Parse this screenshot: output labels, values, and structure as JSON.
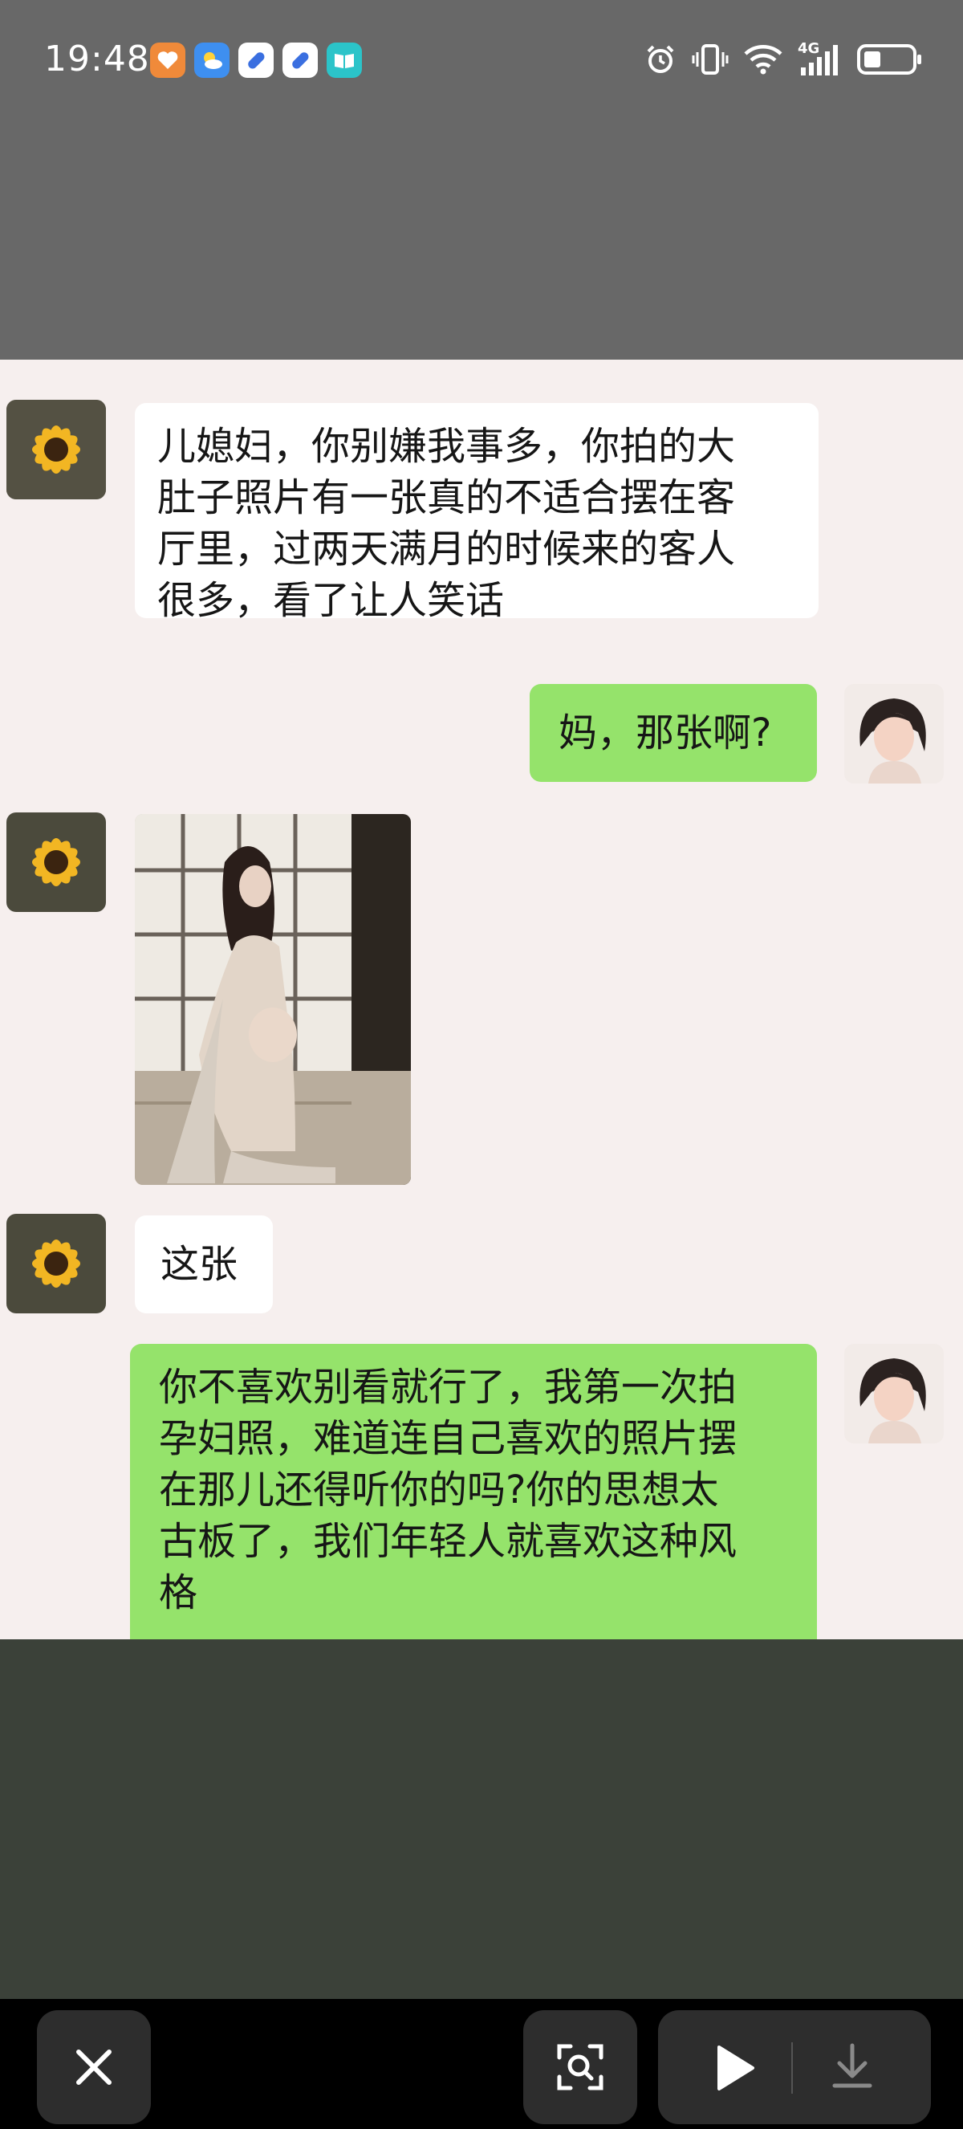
{
  "status_bar": {
    "time": "19:48",
    "app_icons": [
      "heart-app-icon",
      "weather-app-icon",
      "pill-app-icon",
      "pill-app-icon",
      "book-app-icon"
    ],
    "network": "4G",
    "indicators": [
      "alarm-icon",
      "vibrate-icon",
      "wifi-icon",
      "signal-icon",
      "battery-icon"
    ]
  },
  "chat": {
    "messages": [
      {
        "sender": "mother-in-law",
        "type": "text",
        "lines": [
          "儿媳妇，你别嫌我事多，你拍的大",
          "肚子照片有一张真的不适合摆在客",
          "厅里，过两天满月的时候来的客人",
          "很多，看了让人笑话"
        ]
      },
      {
        "sender": "self",
        "type": "text",
        "lines": [
          "妈，那张啊?"
        ]
      },
      {
        "sender": "mother-in-law",
        "type": "image",
        "image": "maternity-photo"
      },
      {
        "sender": "mother-in-law",
        "type": "text",
        "lines": [
          "这张"
        ]
      },
      {
        "sender": "self",
        "type": "text",
        "lines": [
          "你不喜欢别看就行了，我第一次拍",
          "孕妇照，难道连自己喜欢的照片摆",
          "在那儿还得听你的吗?你的思想太",
          "古板了，我们年轻人就喜欢这种风",
          "格"
        ]
      }
    ]
  },
  "toolbar": {
    "close": "close-icon",
    "scan": "scan-icon",
    "play": "play-icon",
    "download": "download-icon"
  },
  "colors": {
    "top_gray": "#686868",
    "chat_bg": "#f6efee",
    "green_bubble": "#95e36b",
    "white_bubble": "#ffffff",
    "bottom_dark": "#3b4139",
    "toolbar_bg": "#000000"
  }
}
